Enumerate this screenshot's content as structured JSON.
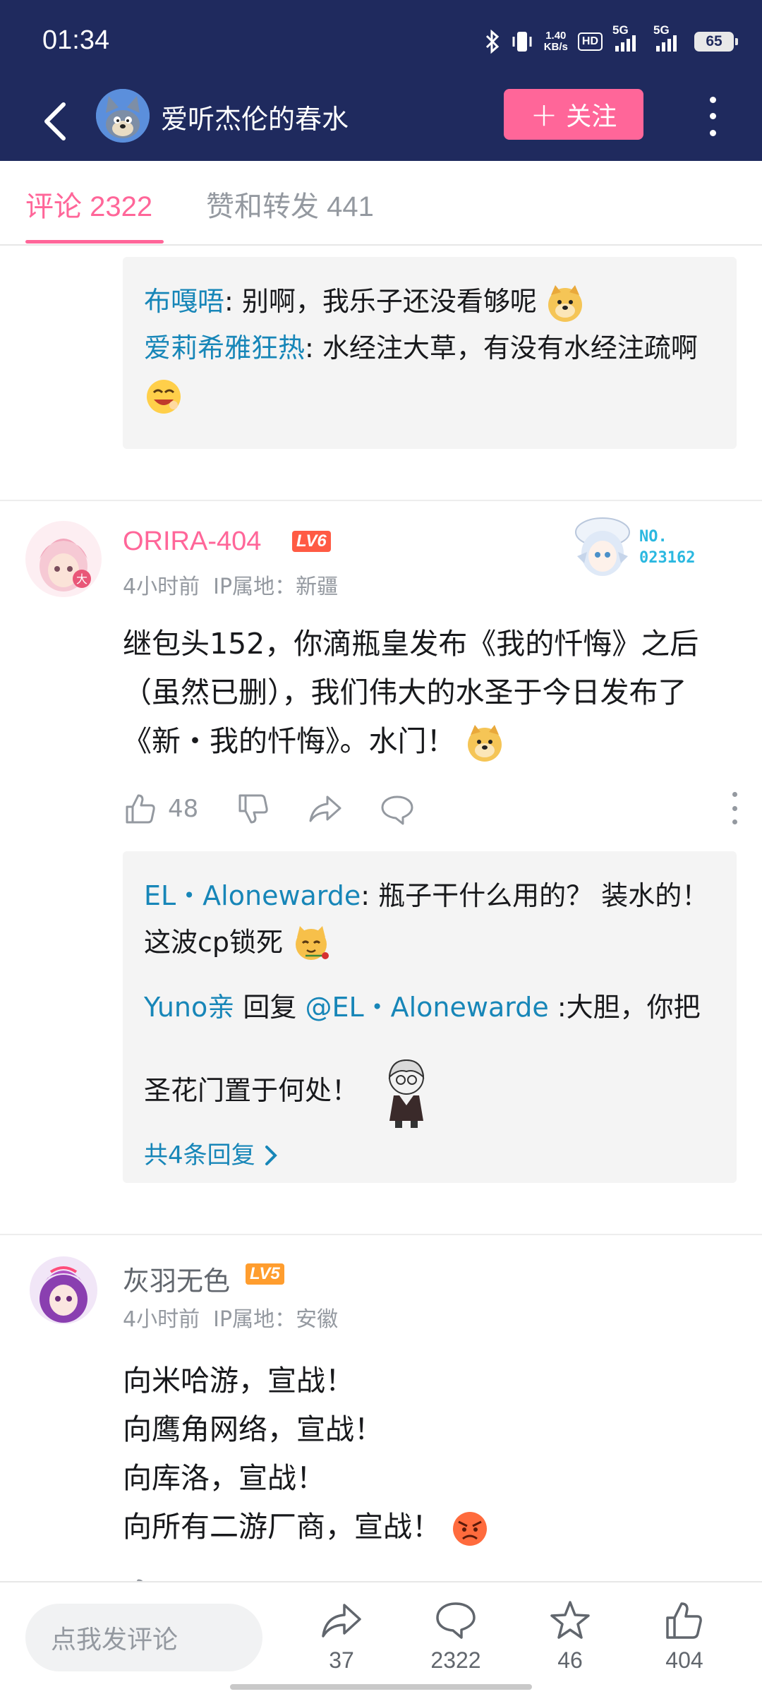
{
  "status_bar": {
    "time": "01:34",
    "net_speed_value": "1.40",
    "net_speed_unit": "KB/s",
    "hd_label": "HD",
    "signal1_label": "5G",
    "signal2_label": "5G",
    "battery": "65"
  },
  "header": {
    "up_name": "爱听杰伦的春水",
    "follow_label": "关注",
    "follow_plus": "+"
  },
  "tabs": {
    "comments": "评论 2322",
    "likes": "赞和转发 441"
  },
  "comment0_replies": [
    {
      "user": "布嘎唔",
      "sep": ": ",
      "text": "别啊，我乐子还没看够呢",
      "emoji": "doge-emoji"
    },
    {
      "user": "爱莉希雅狂热",
      "sep": ": ",
      "text": "水经注大草，有没有水经注疏啊",
      "emoji": "laugh-emoji"
    }
  ],
  "comment1": {
    "user": "ORIRA-404",
    "level": "LV6",
    "time": "4小时前",
    "ip": "IP属地：新疆",
    "badge_no": "NO.",
    "badge_id": "023162",
    "content": "继包头152，你滴瓶皇发布《我的忏悔》之后（虽然已删），我们伟大的水圣于今日发布了《新・我的忏悔》。水门！",
    "likes": "48",
    "replies": [
      {
        "user": "EL・Alonewarde",
        "sep": ": ",
        "text": "瓶子干什么用的？ 装水的！ 这波cp锁死"
      },
      {
        "user": "Yuno亲",
        "reply_word": " 回复 ",
        "target": "@EL・Alonewarde",
        "text": " :大胆，你把圣花门置于何处！"
      }
    ],
    "more_replies": "共4条回复"
  },
  "comment2": {
    "user": "灰羽无色",
    "level": "LV5",
    "time": "4小时前",
    "ip": "IP属地：安徽",
    "lines": [
      "向米哈游，宣战！",
      "向鹰角网络，宣战！",
      "向库洛，宣战！",
      "向所有二游厂商，宣战！"
    ]
  },
  "bottom_bar": {
    "input_placeholder": "点我发评论",
    "share_count": "37",
    "comment_count": "2322",
    "favorite_count": "46",
    "like_count": "404"
  },
  "colors": {
    "header_bg": "#1f2a5e",
    "accent_pink": "#ff6699",
    "link_blue": "#1786b8",
    "lv6": "#ff5b44",
    "lv5": "#ff9d2e"
  }
}
